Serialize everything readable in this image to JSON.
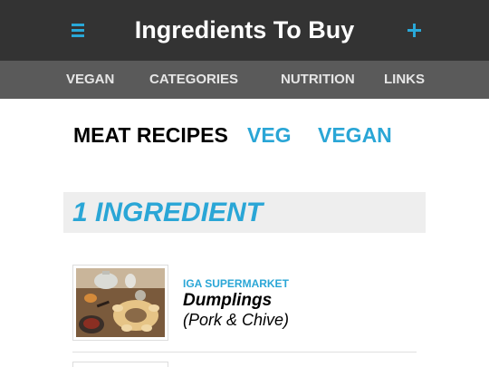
{
  "header": {
    "title": "Ingredients To Buy",
    "menu_icon": "hamburger-icon",
    "add_icon": "plus-icon"
  },
  "nav": {
    "items": [
      "VEGAN",
      "CATEGORIES",
      "NUTRITION",
      "LINKS"
    ]
  },
  "filters": {
    "items": [
      "MEAT RECIPES",
      "VEG",
      "VEGAN"
    ],
    "active": "MEAT RECIPES"
  },
  "section": {
    "title": "1 INGREDIENT"
  },
  "recipes": [
    {
      "store": "IGA SUPERMARKET",
      "name": "Dumplings",
      "variant": "(Pork & Chive)"
    }
  ],
  "colors": {
    "accent": "#2aa6d6",
    "topbar": "#333333",
    "navbar": "#5a5a5a"
  }
}
